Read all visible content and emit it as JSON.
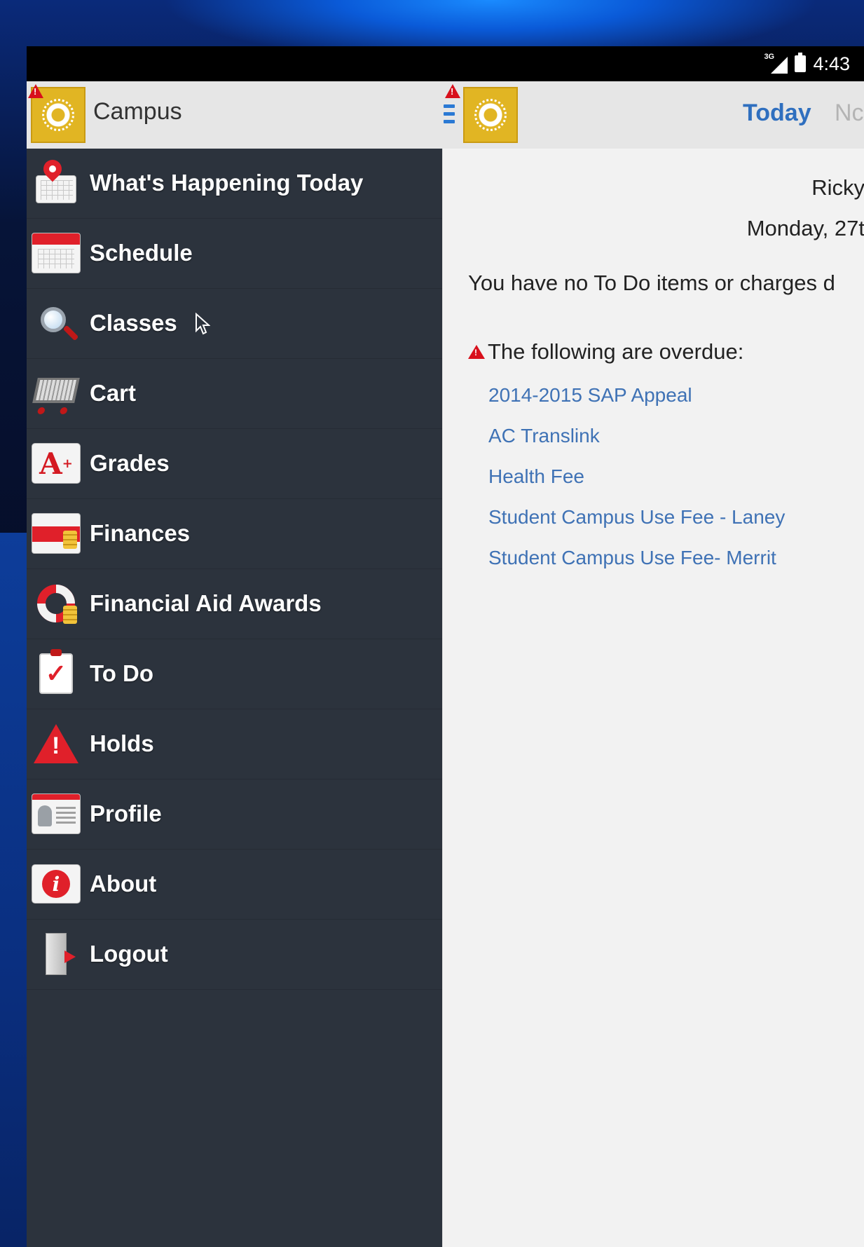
{
  "status_bar": {
    "network": "3G",
    "time": "4:43"
  },
  "app_bar": {
    "title": "Campus",
    "tabs": [
      {
        "label": "Today",
        "selected": true
      },
      {
        "label": "Nc",
        "selected": false
      }
    ]
  },
  "drawer": {
    "items": [
      {
        "label": "What's Happening Today",
        "icon": "calendar-pin-icon"
      },
      {
        "label": "Schedule",
        "icon": "calendar-icon"
      },
      {
        "label": "Classes",
        "icon": "magnifier-icon"
      },
      {
        "label": "Cart",
        "icon": "shopping-cart-icon"
      },
      {
        "label": "Grades",
        "icon": "grade-a-plus-icon"
      },
      {
        "label": "Finances",
        "icon": "credit-card-coins-icon"
      },
      {
        "label": "Financial Aid Awards",
        "icon": "life-ring-icon"
      },
      {
        "label": "To Do",
        "icon": "clipboard-check-icon"
      },
      {
        "label": "Holds",
        "icon": "warning-icon"
      },
      {
        "label": "Profile",
        "icon": "id-card-icon"
      },
      {
        "label": "About",
        "icon": "info-icon"
      },
      {
        "label": "Logout",
        "icon": "door-exit-icon"
      }
    ]
  },
  "main": {
    "name": "Ricky",
    "date": "Monday, 27t",
    "todo_message": "You have no To Do items or charges d",
    "overdue_heading": "The following are overdue:",
    "overdue_items": [
      "2014-2015 SAP Appeal",
      "AC Translink",
      "Health Fee",
      "Student Campus Use Fee - Laney",
      "Student Campus Use Fee- Merrit"
    ]
  },
  "colors": {
    "accent": "#2f6fbf",
    "link": "#3f72b5",
    "drawer_bg": "#2c333d",
    "logo_gold": "#e1b523",
    "alert_red": "#d8101c"
  }
}
